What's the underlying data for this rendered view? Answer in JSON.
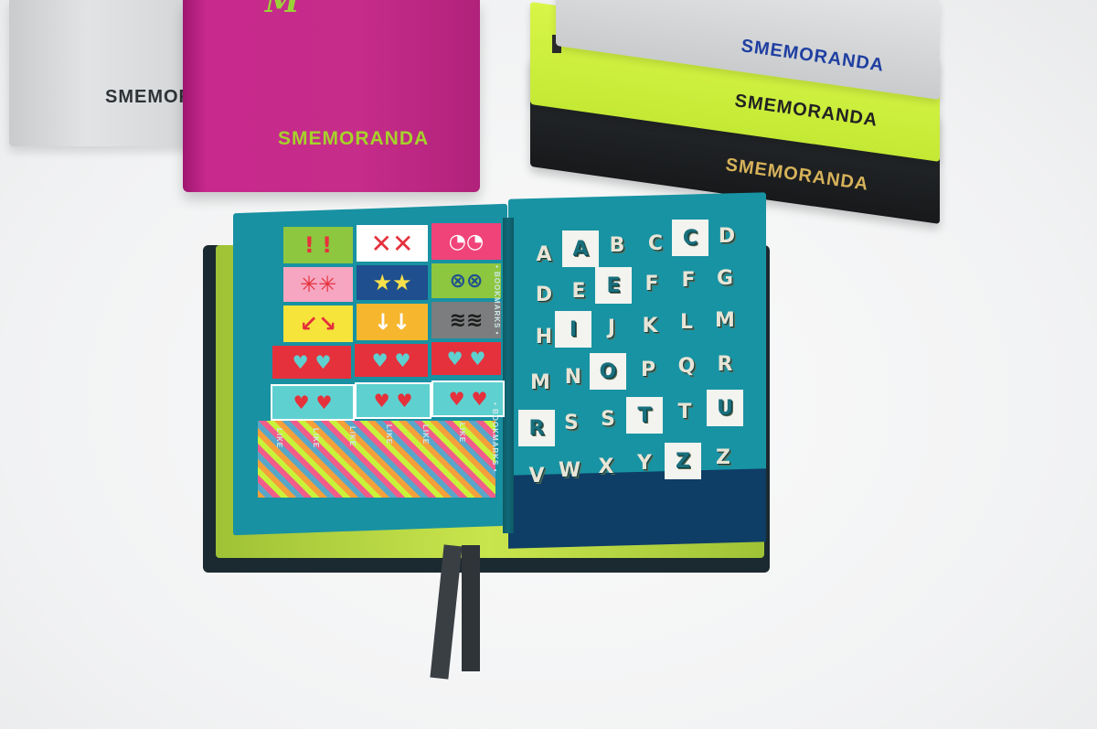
{
  "brand": {
    "name": "SMEMORANDA",
    "script_text": "M"
  },
  "left_page": {
    "side_label_top": "• BOOKMARKS •",
    "side_label_bottom": "• BOOKMARKS •",
    "stripe_text": "LIKE"
  },
  "right_page": {
    "letters": [
      "A",
      "A",
      "B",
      "C",
      "C",
      "D",
      "D",
      "E",
      "E",
      "F",
      "F",
      "G",
      "H",
      "I",
      "J",
      "K",
      "L",
      "M",
      "M",
      "N",
      "O",
      "P",
      "Q",
      "R",
      "R",
      "S",
      "S",
      "T",
      "T",
      "U",
      "V",
      "W",
      "X",
      "Y",
      "Z",
      "Z"
    ]
  },
  "colors": {
    "page_teal": "#1893a3",
    "lime": "#c9f23a",
    "magenta": "#c62c8a",
    "silver": "#d3d5d7",
    "black_book": "#1e2022"
  }
}
